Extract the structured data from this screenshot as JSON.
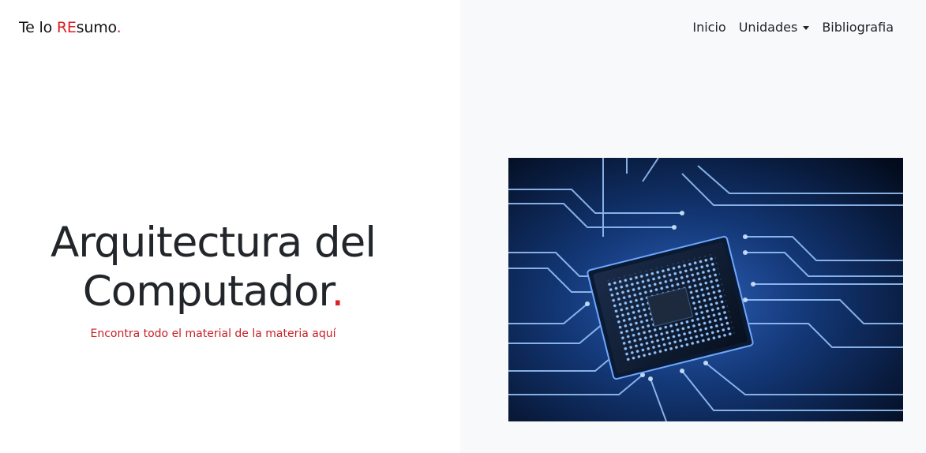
{
  "header": {
    "brand_part1": "Te lo ",
    "brand_part2": "RE",
    "brand_part3": "sumo",
    "brand_part4": "."
  },
  "nav": {
    "items": [
      {
        "label": "Inicio"
      },
      {
        "label": "Unidades"
      },
      {
        "label": "Bibliografia"
      }
    ]
  },
  "hero": {
    "title_line1": "Arquitectura del",
    "title_line2": "Computador",
    "title_dot": ".",
    "subtitle": "Encontra todo el material de la materia aquí"
  },
  "image": {
    "alt": "circuit board with microchip"
  },
  "colors": {
    "accent": "#dc1e24",
    "panel_bg": "#f8f9fa",
    "text": "#212529"
  }
}
